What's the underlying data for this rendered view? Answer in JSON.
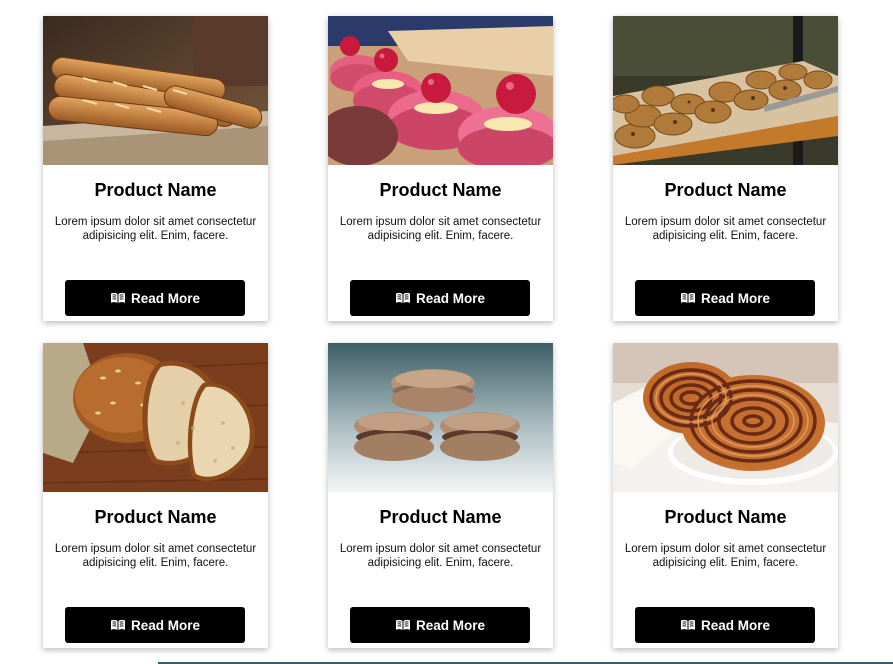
{
  "cards": [
    {
      "image": "baguettes-photo",
      "title": "Product Name",
      "description": "Lorem ipsum dolor sit amet consectetur adipisicing elit. Enim, facere.",
      "button_label": "Read More",
      "button_icon": "book-open-icon"
    },
    {
      "image": "pink-macarons-photo",
      "title": "Product Name",
      "description": "Lorem ipsum dolor sit amet consectetur adipisicing elit. Enim, facere.",
      "button_label": "Read More",
      "button_icon": "book-open-icon"
    },
    {
      "image": "cookies-tray-photo",
      "title": "Product Name",
      "description": "Lorem ipsum dolor sit amet consectetur adipisicing elit. Enim, facere.",
      "button_label": "Read More",
      "button_icon": "book-open-icon"
    },
    {
      "image": "sliced-bread-photo",
      "title": "Product Name",
      "description": "Lorem ipsum dolor sit amet consectetur adipisicing elit. Enim, facere.",
      "button_label": "Read More",
      "button_icon": "book-open-icon"
    },
    {
      "image": "brown-macarons-photo",
      "title": "Product Name",
      "description": "Lorem ipsum dolor sit amet consectetur adipisicing elit. Enim, facere.",
      "button_label": "Read More",
      "button_icon": "book-open-icon"
    },
    {
      "image": "cinnamon-rolls-photo",
      "title": "Product Name",
      "description": "Lorem ipsum dolor sit amet consectetur adipisicing elit. Enim, facere.",
      "button_label": "Read More",
      "button_icon": "book-open-icon"
    }
  ],
  "colors": {
    "button_background": "#000000",
    "button_text": "#ffffff",
    "card_background": "#ffffff"
  }
}
